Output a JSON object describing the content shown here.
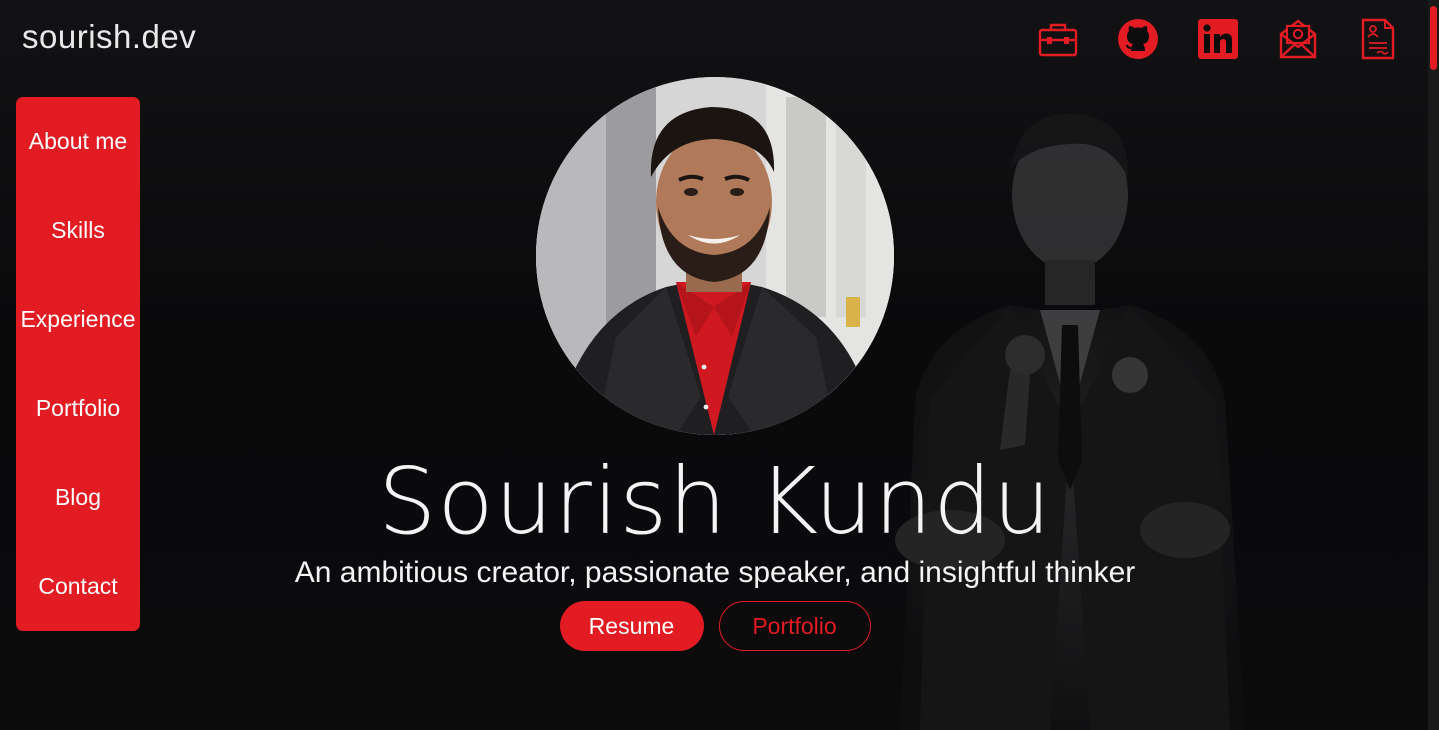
{
  "brand": "sourish.dev",
  "colors": {
    "accent": "#e31b23",
    "background": "#0c0c0d",
    "text": "#f4f4f4"
  },
  "social": [
    {
      "name": "portfolio-briefcase-icon",
      "label": "Portfolio"
    },
    {
      "name": "github-icon",
      "label": "GitHub"
    },
    {
      "name": "linkedin-icon",
      "label": "LinkedIn"
    },
    {
      "name": "email-icon",
      "label": "Email"
    },
    {
      "name": "resume-document-icon",
      "label": "Resume"
    }
  ],
  "sidebar": {
    "items": [
      {
        "label": "About me"
      },
      {
        "label": "Skills"
      },
      {
        "label": "Experience"
      },
      {
        "label": "Portfolio"
      },
      {
        "label": "Blog"
      },
      {
        "label": "Contact"
      }
    ]
  },
  "hero": {
    "name": "Sourish Kundu",
    "tagline": "An ambitious creator, passionate speaker, and insightful thinker",
    "primary_button": "Resume",
    "secondary_button": "Portfolio"
  }
}
